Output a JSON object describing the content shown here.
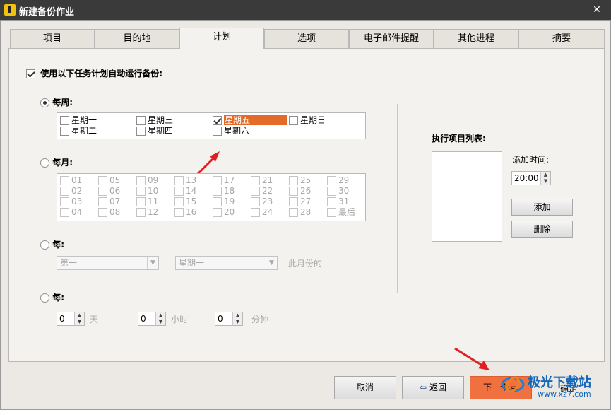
{
  "window": {
    "title": "新建备份作业",
    "close_glyph": "✕"
  },
  "tabs": [
    "项目",
    "目的地",
    "计划",
    "选项",
    "电子邮件提醒",
    "其他进程",
    "摘要"
  ],
  "active_tab": 2,
  "schedule": {
    "enable_label": "使用以下任务计划自动运行备份:",
    "enable_checked": true,
    "weekly": {
      "label": "每周:",
      "selected": true,
      "days": [
        {
          "label": "星期一",
          "checked": false
        },
        {
          "label": "星期三",
          "checked": false
        },
        {
          "label": "星期五",
          "checked": true,
          "highlighted": true
        },
        {
          "label": "星期日",
          "checked": false
        },
        {
          "label": "星期二",
          "checked": false
        },
        {
          "label": "星期四",
          "checked": false
        },
        {
          "label": "星期六",
          "checked": false
        }
      ]
    },
    "monthly": {
      "label": "每月:",
      "selected": false,
      "days": [
        "01",
        "05",
        "09",
        "13",
        "17",
        "21",
        "25",
        "29",
        "02",
        "06",
        "10",
        "14",
        "18",
        "22",
        "26",
        "30",
        "03",
        "07",
        "11",
        "15",
        "19",
        "23",
        "27",
        "31",
        "04",
        "08",
        "12",
        "16",
        "20",
        "24",
        "28",
        "最后"
      ]
    },
    "every_nth": {
      "label": "每:",
      "selected": false,
      "ordinal_value": "第一",
      "weekday_value": "星期一",
      "suffix": "此月份的"
    },
    "interval": {
      "label": "每:",
      "selected": false,
      "days_value": "0",
      "days_unit": "天",
      "hours_value": "0",
      "hours_unit": "小时",
      "minutes_value": "0",
      "minutes_unit": "分钟"
    }
  },
  "run_list": {
    "label": "执行项目列表:",
    "add_time_label": "添加时间:",
    "time_value": "20:00",
    "add_button": "添加",
    "delete_button": "删除"
  },
  "footer": {
    "cancel": "取消",
    "back": "返回",
    "next": "下一个",
    "ok": "确定"
  },
  "watermark": {
    "brand": "极光下载站",
    "url": "www.xz7.com"
  },
  "colors": {
    "highlight": "#e46a29",
    "arrow": "#e02020",
    "next_button": "#f07040",
    "titlebar": "#3a3a3a"
  }
}
